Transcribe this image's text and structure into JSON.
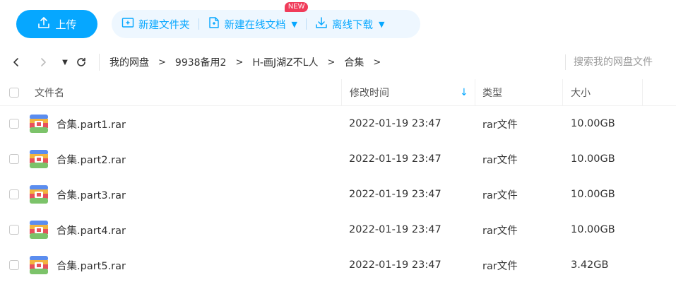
{
  "toolbar": {
    "upload_label": "上传",
    "new_folder_label": "新建文件夹",
    "new_online_doc_label": "新建在线文档",
    "new_badge": "NEW",
    "offline_download_label": "离线下载",
    "accent_color": "#06a7ff"
  },
  "nav": {
    "refresh_icon": "refresh-icon",
    "breadcrumbs": [
      "我的网盘",
      "9938备用2",
      "H-画J湖Z不L人",
      "合集"
    ],
    "search_placeholder": "搜索我的网盘文件"
  },
  "table": {
    "columns": [
      "文件名",
      "修改时间",
      "类型",
      "大小"
    ],
    "sorted_column": "修改时间",
    "sort_direction": "descending",
    "rows": [
      {
        "name": "合集.part1.rar",
        "modified": "2022-01-19 23:47",
        "type": "rar文件",
        "size": "10.00GB"
      },
      {
        "name": "合集.part2.rar",
        "modified": "2022-01-19 23:47",
        "type": "rar文件",
        "size": "10.00GB"
      },
      {
        "name": "合集.part3.rar",
        "modified": "2022-01-19 23:47",
        "type": "rar文件",
        "size": "10.00GB"
      },
      {
        "name": "合集.part4.rar",
        "modified": "2022-01-19 23:47",
        "type": "rar文件",
        "size": "10.00GB"
      },
      {
        "name": "合集.part5.rar",
        "modified": "2022-01-19 23:47",
        "type": "rar文件",
        "size": "3.42GB"
      }
    ]
  }
}
